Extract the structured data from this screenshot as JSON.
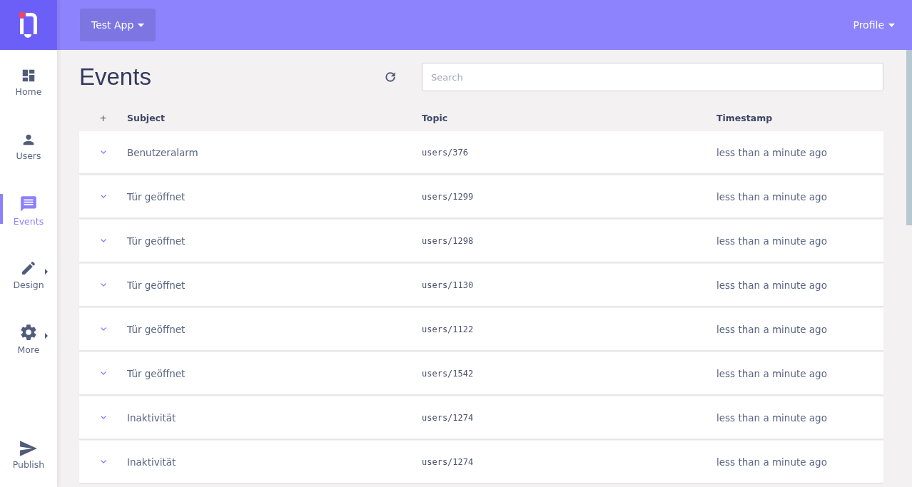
{
  "topbar": {
    "app_menu": {
      "label": "Test App"
    },
    "profile_menu": {
      "label": "Profile"
    }
  },
  "sidebar": {
    "items": [
      {
        "label": "Home",
        "selected": false,
        "has_submenu": false
      },
      {
        "label": "Users",
        "selected": false,
        "has_submenu": false
      },
      {
        "label": "Events",
        "selected": true,
        "has_submenu": false
      },
      {
        "label": "Design",
        "selected": false,
        "has_submenu": true
      },
      {
        "label": "More",
        "selected": false,
        "has_submenu": true
      }
    ],
    "footer_item": {
      "label": "Publish"
    }
  },
  "page": {
    "title": "Events",
    "search": {
      "placeholder": "Search"
    }
  },
  "table": {
    "columns": [
      "+",
      "Subject",
      "Topic",
      "Timestamp"
    ],
    "rows": [
      {
        "subject": "Benutzeralarm",
        "topic": "users/376",
        "timestamp": "less than a minute ago"
      },
      {
        "subject": "Tür geöffnet",
        "topic": "users/1299",
        "timestamp": "less than a minute ago"
      },
      {
        "subject": "Tür geöffnet",
        "topic": "users/1298",
        "timestamp": "less than a minute ago"
      },
      {
        "subject": "Tür geöffnet",
        "topic": "users/1130",
        "timestamp": "less than a minute ago"
      },
      {
        "subject": "Tür geöffnet",
        "topic": "users/1122",
        "timestamp": "less than a minute ago"
      },
      {
        "subject": "Tür geöffnet",
        "topic": "users/1542",
        "timestamp": "less than a minute ago"
      },
      {
        "subject": "Inaktivität",
        "topic": "users/1274",
        "timestamp": "less than a minute ago"
      },
      {
        "subject": "Inaktivität",
        "topic": "users/1274",
        "timestamp": "less than a minute ago"
      }
    ]
  }
}
